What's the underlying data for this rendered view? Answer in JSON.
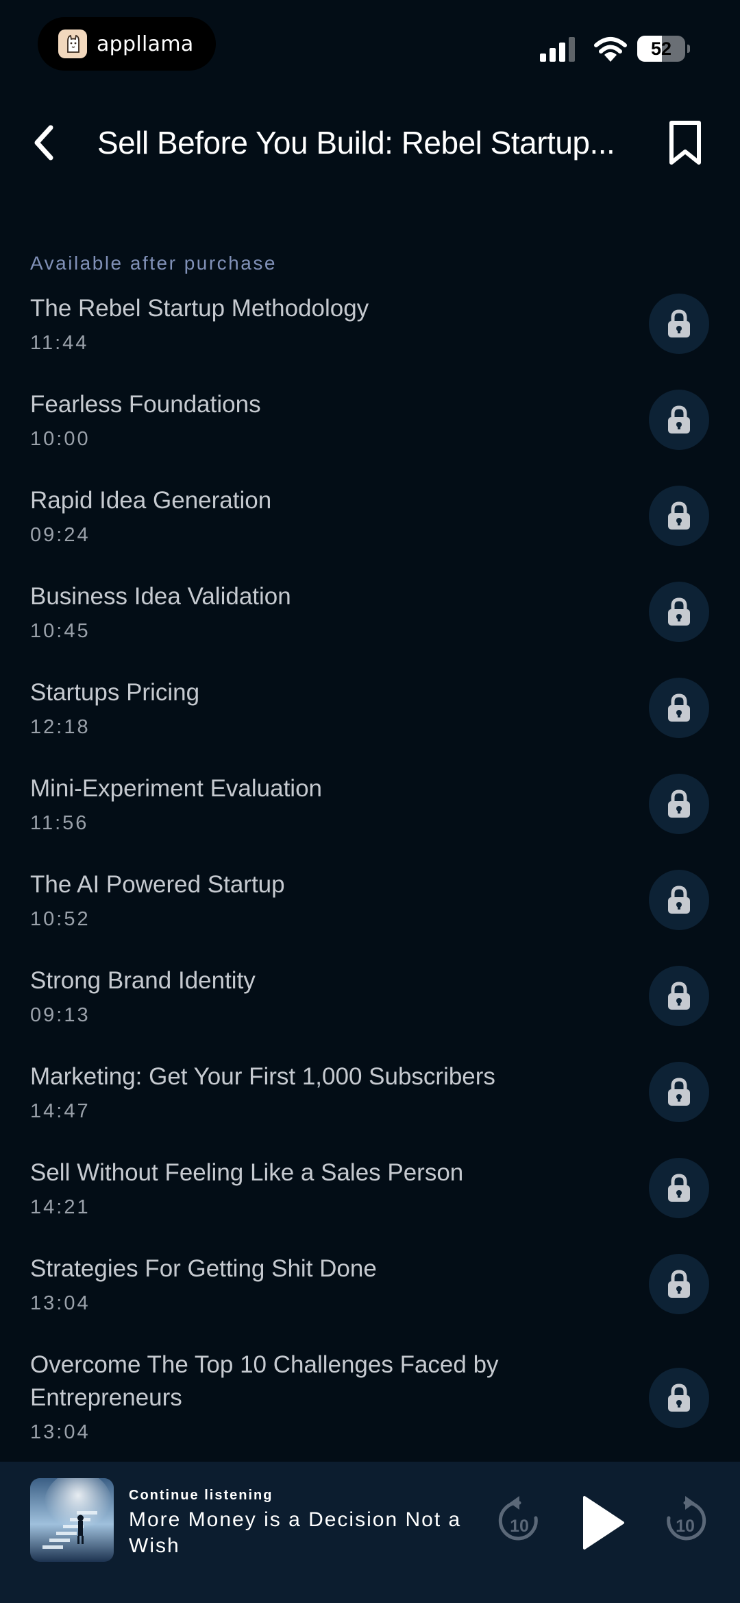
{
  "status_bar": {
    "app_name": "appllama",
    "battery_level": "52",
    "battery_fraction": 0.52
  },
  "header": {
    "title": "Sell Before You Build: Rebel Startup..."
  },
  "section_label": "Available after purchase",
  "chapters": [
    {
      "title": "The Rebel Startup Methodology",
      "duration": "11:44"
    },
    {
      "title": "Fearless Foundations",
      "duration": "10:00"
    },
    {
      "title": "Rapid Idea Generation",
      "duration": "09:24"
    },
    {
      "title": "Business Idea Validation",
      "duration": "10:45"
    },
    {
      "title": "Startups Pricing",
      "duration": "12:18"
    },
    {
      "title": "Mini-Experiment Evaluation",
      "duration": "11:56"
    },
    {
      "title": "The AI Powered Startup",
      "duration": "10:52"
    },
    {
      "title": "Strong Brand Identity",
      "duration": "09:13"
    },
    {
      "title": "Marketing: Get Your First 1,000 Subscribers",
      "duration": "14:47"
    },
    {
      "title": "Sell Without Feeling Like a Sales Person",
      "duration": "14:21"
    },
    {
      "title": "Strategies For Getting Shit Done",
      "duration": "13:04"
    },
    {
      "title": "Overcome The Top 10 Challenges Faced by Entrepreneurs",
      "duration": "13:04"
    }
  ],
  "player": {
    "label": "Continue listening",
    "track": "More Money is a Decision Not a Wish",
    "skip_back_seconds": "10",
    "skip_forward_seconds": "10"
  },
  "colors": {
    "background": "#030d16",
    "lock_button": "#0d2235",
    "player_background": "#0c1d2f",
    "section_label": "#8191b8"
  },
  "icons": {
    "back": "chevron-left-icon",
    "bookmark": "bookmark-icon",
    "lock": "lock-icon",
    "replay": "replay-10-icon",
    "play": "play-icon",
    "forward": "forward-10-icon"
  }
}
